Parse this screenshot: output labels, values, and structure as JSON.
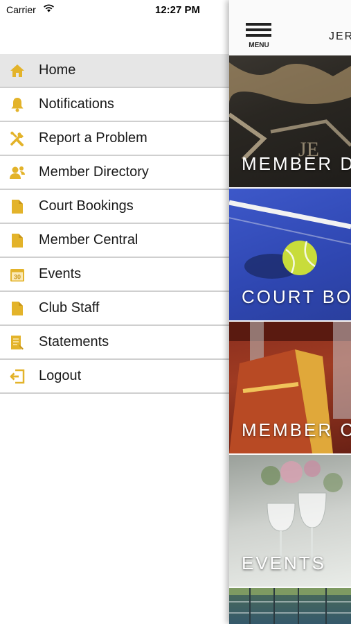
{
  "status_bar": {
    "carrier": "Carrier",
    "time": "12:27 PM"
  },
  "drawer": {
    "items": [
      {
        "label": "Home",
        "icon": "home-icon",
        "active": true
      },
      {
        "label": "Notifications",
        "icon": "bell-icon"
      },
      {
        "label": "Report a Problem",
        "icon": "tools-icon"
      },
      {
        "label": "Member Directory",
        "icon": "members-icon"
      },
      {
        "label": "Court Bookings",
        "icon": "document-icon"
      },
      {
        "label": "Member Central",
        "icon": "document-icon"
      },
      {
        "label": "Events",
        "icon": "calendar-icon",
        "calendar_day": "30"
      },
      {
        "label": "Club Staff",
        "icon": "document-icon"
      },
      {
        "label": "Statements",
        "icon": "statement-icon"
      },
      {
        "label": "Logout",
        "icon": "logout-icon"
      }
    ]
  },
  "header": {
    "menu_label": "MENU",
    "brand": "JER"
  },
  "tiles": [
    {
      "label": "MEMBER D"
    },
    {
      "label": "COURT BOO"
    },
    {
      "label": "MEMBER C"
    },
    {
      "label": "EVENTS"
    },
    {
      "label": ""
    }
  ],
  "colors": {
    "accent": "#E3B32A",
    "divider": "#CFCFCF",
    "active_row": "#E6E6E6"
  }
}
